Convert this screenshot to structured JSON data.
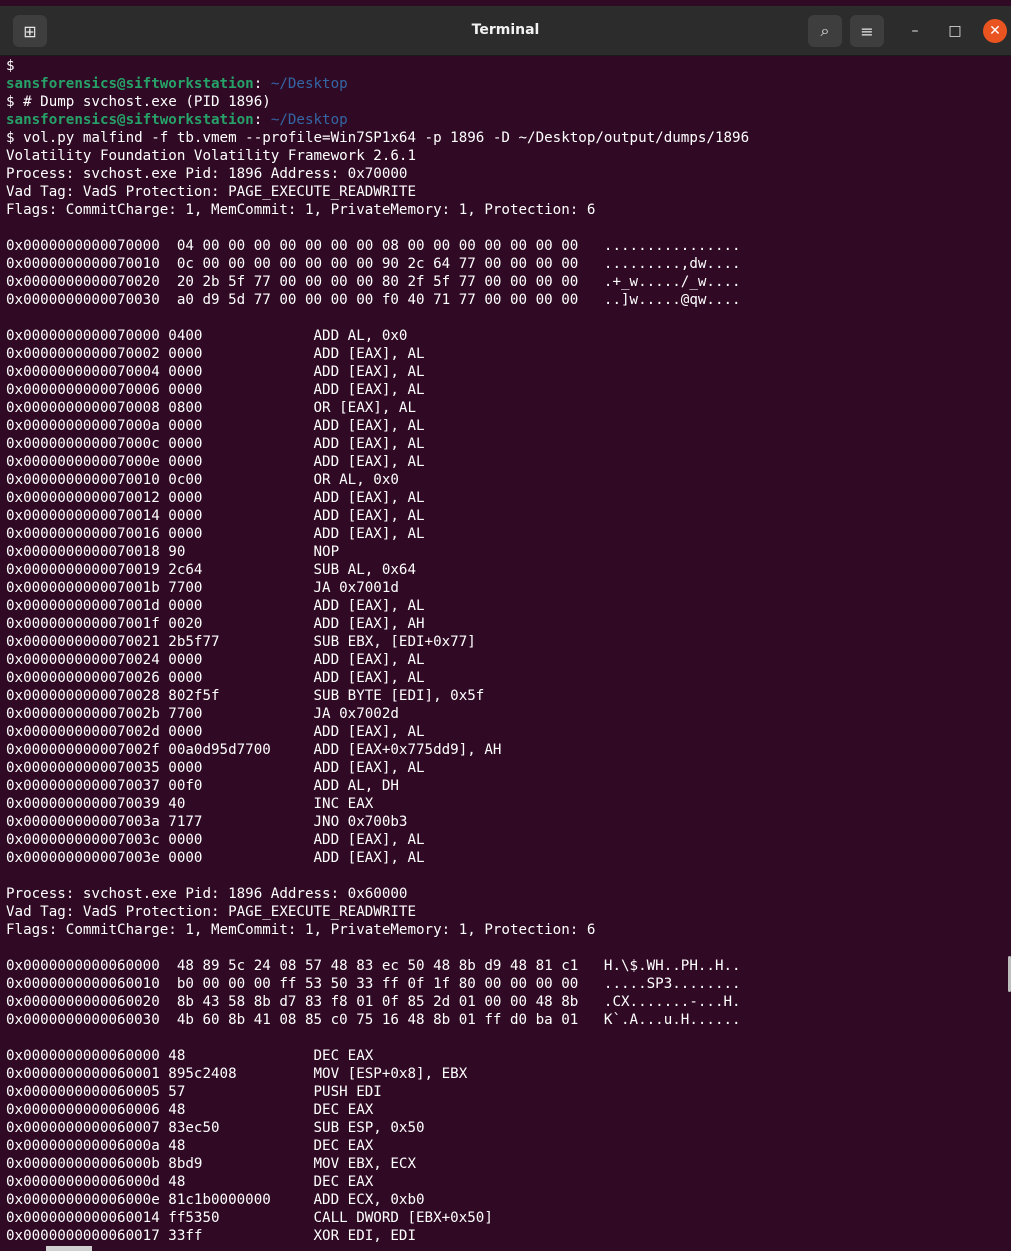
{
  "window": {
    "title": "Terminal",
    "new_tab_glyph": "⊞",
    "search_glyph": "⌕",
    "menu_glyph": "≡",
    "minimize_glyph": "–",
    "maximize_glyph": "□",
    "close_glyph": "✕"
  },
  "terminal": {
    "lines": [
      {
        "type": "plain",
        "text": "$"
      },
      {
        "type": "prompt",
        "user": "sansforensics@siftworkstation",
        "sep": ": ",
        "path": "~/Desktop"
      },
      {
        "type": "plain",
        "text": "$ # Dump svchost.exe (PID 1896)"
      },
      {
        "type": "prompt",
        "user": "sansforensics@siftworkstation",
        "sep": ": ",
        "path": "~/Desktop"
      },
      {
        "type": "plain",
        "text": "$ vol.py malfind -f tb.vmem --profile=Win7SP1x64 -p 1896 -D ~/Desktop/output/dumps/1896"
      },
      {
        "type": "plain",
        "text": "Volatility Foundation Volatility Framework 2.6.1"
      },
      {
        "type": "plain",
        "text": "Process: svchost.exe Pid: 1896 Address: 0x70000"
      },
      {
        "type": "plain",
        "text": "Vad Tag: VadS Protection: PAGE_EXECUTE_READWRITE"
      },
      {
        "type": "plain",
        "text": "Flags: CommitCharge: 1, MemCommit: 1, PrivateMemory: 1, Protection: 6"
      },
      {
        "type": "plain",
        "text": ""
      },
      {
        "type": "plain",
        "text": "0x0000000000070000  04 00 00 00 00 00 00 00 08 00 00 00 00 00 00 00   ................"
      },
      {
        "type": "plain",
        "text": "0x0000000000070010  0c 00 00 00 00 00 00 00 90 2c 64 77 00 00 00 00   .........,dw...."
      },
      {
        "type": "plain",
        "text": "0x0000000000070020  20 2b 5f 77 00 00 00 00 80 2f 5f 77 00 00 00 00   .+_w...../_w...."
      },
      {
        "type": "plain",
        "text": "0x0000000000070030  a0 d9 5d 77 00 00 00 00 f0 40 71 77 00 00 00 00   ..]w.....@qw...."
      },
      {
        "type": "plain",
        "text": ""
      },
      {
        "type": "plain",
        "text": "0x0000000000070000 0400             ADD AL, 0x0"
      },
      {
        "type": "plain",
        "text": "0x0000000000070002 0000             ADD [EAX], AL"
      },
      {
        "type": "plain",
        "text": "0x0000000000070004 0000             ADD [EAX], AL"
      },
      {
        "type": "plain",
        "text": "0x0000000000070006 0000             ADD [EAX], AL"
      },
      {
        "type": "plain",
        "text": "0x0000000000070008 0800             OR [EAX], AL"
      },
      {
        "type": "plain",
        "text": "0x000000000007000a 0000             ADD [EAX], AL"
      },
      {
        "type": "plain",
        "text": "0x000000000007000c 0000             ADD [EAX], AL"
      },
      {
        "type": "plain",
        "text": "0x000000000007000e 0000             ADD [EAX], AL"
      },
      {
        "type": "plain",
        "text": "0x0000000000070010 0c00             OR AL, 0x0"
      },
      {
        "type": "plain",
        "text": "0x0000000000070012 0000             ADD [EAX], AL"
      },
      {
        "type": "plain",
        "text": "0x0000000000070014 0000             ADD [EAX], AL"
      },
      {
        "type": "plain",
        "text": "0x0000000000070016 0000             ADD [EAX], AL"
      },
      {
        "type": "plain",
        "text": "0x0000000000070018 90               NOP"
      },
      {
        "type": "plain",
        "text": "0x0000000000070019 2c64             SUB AL, 0x64"
      },
      {
        "type": "plain",
        "text": "0x000000000007001b 7700             JA 0x7001d"
      },
      {
        "type": "plain",
        "text": "0x000000000007001d 0000             ADD [EAX], AL"
      },
      {
        "type": "plain",
        "text": "0x000000000007001f 0020             ADD [EAX], AH"
      },
      {
        "type": "plain",
        "text": "0x0000000000070021 2b5f77           SUB EBX, [EDI+0x77]"
      },
      {
        "type": "plain",
        "text": "0x0000000000070024 0000             ADD [EAX], AL"
      },
      {
        "type": "plain",
        "text": "0x0000000000070026 0000             ADD [EAX], AL"
      },
      {
        "type": "plain",
        "text": "0x0000000000070028 802f5f           SUB BYTE [EDI], 0x5f"
      },
      {
        "type": "plain",
        "text": "0x000000000007002b 7700             JA 0x7002d"
      },
      {
        "type": "plain",
        "text": "0x000000000007002d 0000             ADD [EAX], AL"
      },
      {
        "type": "plain",
        "text": "0x000000000007002f 00a0d95d7700     ADD [EAX+0x775dd9], AH"
      },
      {
        "type": "plain",
        "text": "0x0000000000070035 0000             ADD [EAX], AL"
      },
      {
        "type": "plain",
        "text": "0x0000000000070037 00f0             ADD AL, DH"
      },
      {
        "type": "plain",
        "text": "0x0000000000070039 40               INC EAX"
      },
      {
        "type": "plain",
        "text": "0x000000000007003a 7177             JNO 0x700b3"
      },
      {
        "type": "plain",
        "text": "0x000000000007003c 0000             ADD [EAX], AL"
      },
      {
        "type": "plain",
        "text": "0x000000000007003e 0000             ADD [EAX], AL"
      },
      {
        "type": "plain",
        "text": ""
      },
      {
        "type": "plain",
        "text": "Process: svchost.exe Pid: 1896 Address: 0x60000"
      },
      {
        "type": "plain",
        "text": "Vad Tag: VadS Protection: PAGE_EXECUTE_READWRITE"
      },
      {
        "type": "plain",
        "text": "Flags: CommitCharge: 1, MemCommit: 1, PrivateMemory: 1, Protection: 6"
      },
      {
        "type": "plain",
        "text": ""
      },
      {
        "type": "plain",
        "text": "0x0000000000060000  48 89 5c 24 08 57 48 83 ec 50 48 8b d9 48 81 c1   H.\\$.WH..PH..H.."
      },
      {
        "type": "plain",
        "text": "0x0000000000060010  b0 00 00 00 ff 53 50 33 ff 0f 1f 80 00 00 00 00   .....SP3........"
      },
      {
        "type": "plain",
        "text": "0x0000000000060020  8b 43 58 8b d7 83 f8 01 0f 85 2d 01 00 00 48 8b   .CX.......-...H."
      },
      {
        "type": "plain",
        "text": "0x0000000000060030  4b 60 8b 41 08 85 c0 75 16 48 8b 01 ff d0 ba 01   K`.A...u.H......"
      },
      {
        "type": "plain",
        "text": ""
      },
      {
        "type": "plain",
        "text": "0x0000000000060000 48               DEC EAX"
      },
      {
        "type": "plain",
        "text": "0x0000000000060001 895c2408         MOV [ESP+0x8], EBX"
      },
      {
        "type": "plain",
        "text": "0x0000000000060005 57               PUSH EDI"
      },
      {
        "type": "plain",
        "text": "0x0000000000060006 48               DEC EAX"
      },
      {
        "type": "plain",
        "text": "0x0000000000060007 83ec50           SUB ESP, 0x50"
      },
      {
        "type": "plain",
        "text": "0x000000000006000a 48               DEC EAX"
      },
      {
        "type": "plain",
        "text": "0x000000000006000b 8bd9             MOV EBX, ECX"
      },
      {
        "type": "plain",
        "text": "0x000000000006000d 48               DEC EAX"
      },
      {
        "type": "plain",
        "text": "0x000000000006000e 81c1b0000000     ADD ECX, 0xb0"
      },
      {
        "type": "plain",
        "text": "0x0000000000060014 ff5350           CALL DWORD [EBX+0x50]"
      },
      {
        "type": "plain",
        "text": "0x0000000000060017 33ff             XOR EDI, EDI"
      }
    ]
  }
}
